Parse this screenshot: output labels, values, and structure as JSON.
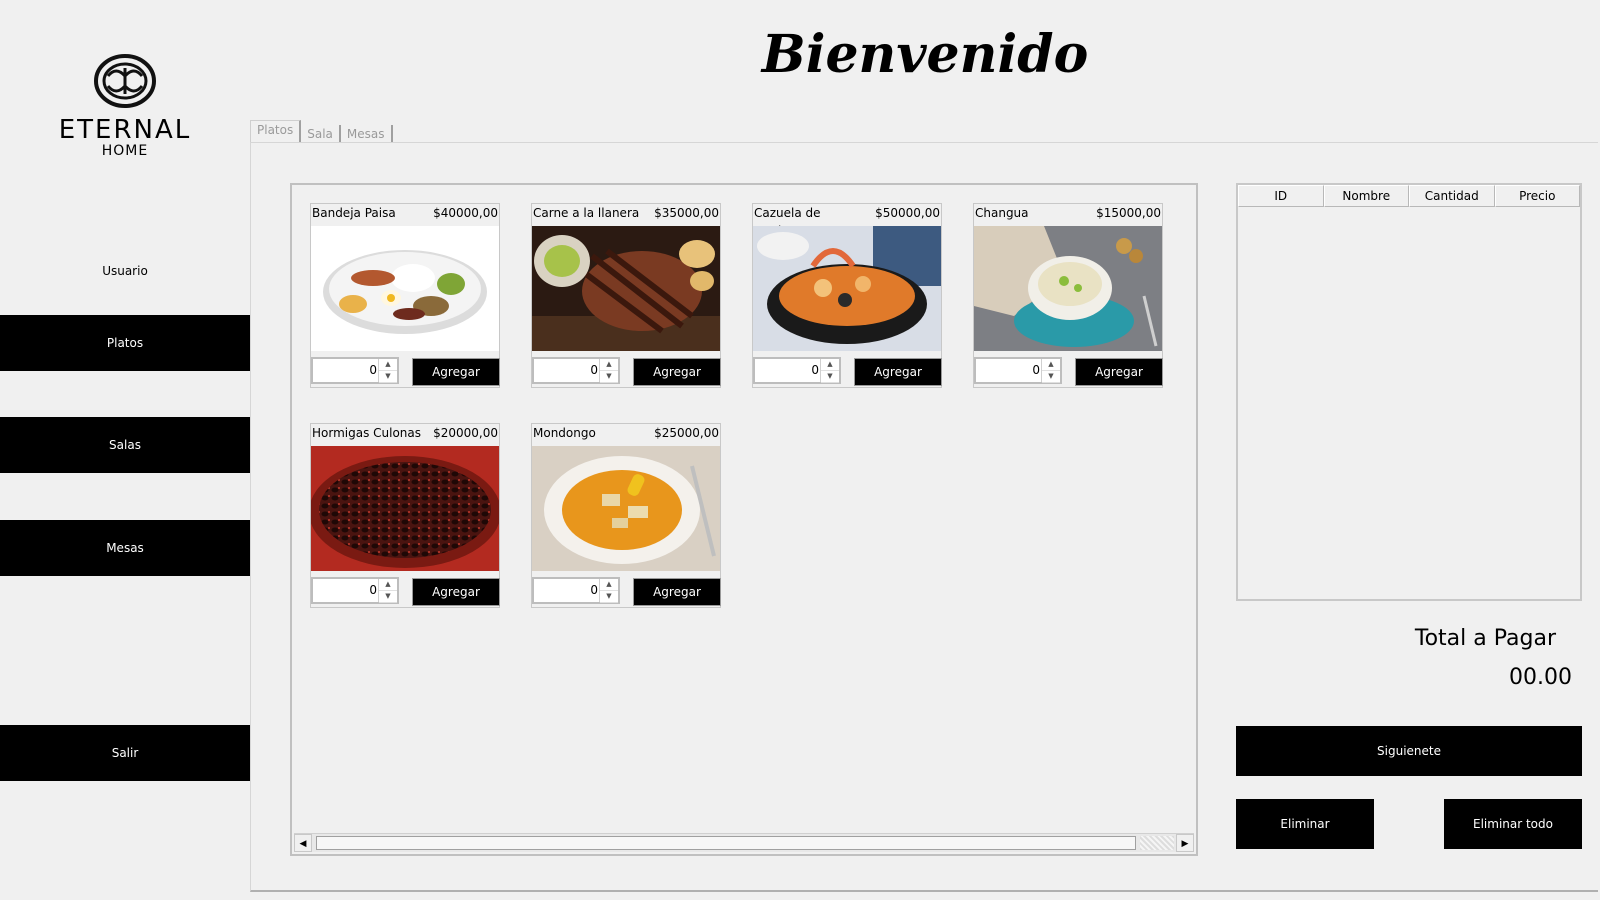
{
  "brand": {
    "name": "ETERNAL",
    "sub": "HOME"
  },
  "sidebar": {
    "user": "Usuario",
    "items": [
      {
        "label": "Platos"
      },
      {
        "label": "Salas"
      },
      {
        "label": "Mesas"
      },
      {
        "label": "Salir"
      }
    ]
  },
  "header": {
    "title": "Bienvenido"
  },
  "tabs": [
    {
      "label": "Platos",
      "active": true
    },
    {
      "label": "Sala",
      "active": false
    },
    {
      "label": "Mesas",
      "active": false
    }
  ],
  "products": [
    {
      "name": "Bandeja Paisa",
      "price": "$40000,00",
      "qty": "0",
      "button": "Agregar",
      "image": "bandeja-paisa"
    },
    {
      "name": "Carne a la llanera",
      "price": "$35000,00",
      "qty": "0",
      "button": "Agregar",
      "image": "carne-llanera"
    },
    {
      "name": "Cazuela de mariscos",
      "price": "$50000,00",
      "qty": "0",
      "button": "Agregar",
      "image": "cazuela-mariscos"
    },
    {
      "name": "Changua",
      "price": "$15000,00",
      "qty": "0",
      "button": "Agregar",
      "image": "changua"
    },
    {
      "name": "Hormigas Culonas",
      "price": "$20000,00",
      "qty": "0",
      "button": "Agregar",
      "image": "hormigas-culonas"
    },
    {
      "name": "Mondongo",
      "price": "$25000,00",
      "qty": "0",
      "button": "Agregar",
      "image": "mondongo"
    }
  ],
  "order": {
    "columns": [
      "ID",
      "Nombre",
      "Cantidad",
      "Precio"
    ],
    "rows": [],
    "total_label": "Total a Pagar",
    "total_value": "00.00",
    "next_button": "Siguienete",
    "delete_button": "Eliminar",
    "delete_all_button": "Eliminar todo"
  }
}
